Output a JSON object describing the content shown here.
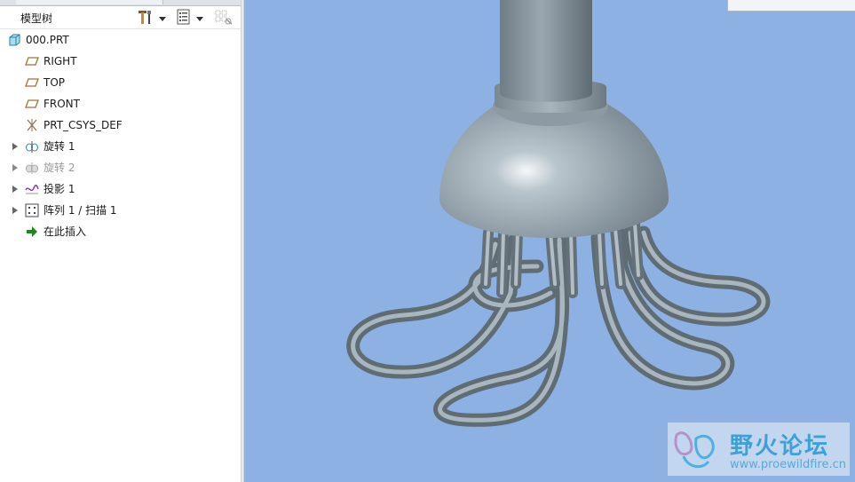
{
  "model_tree": {
    "title": "模型树",
    "nodes": [
      {
        "label": "000.PRT",
        "icon": "part-icon",
        "expander": false,
        "disabled": false
      },
      {
        "label": "RIGHT",
        "icon": "datum-plane-icon",
        "expander": false,
        "disabled": false
      },
      {
        "label": "TOP",
        "icon": "datum-plane-icon",
        "expander": false,
        "disabled": false
      },
      {
        "label": "FRONT",
        "icon": "datum-plane-icon",
        "expander": false,
        "disabled": false
      },
      {
        "label": "PRT_CSYS_DEF",
        "icon": "coordinate-system-icon",
        "expander": false,
        "disabled": false
      },
      {
        "label": "旋转 1",
        "icon": "revolve-icon",
        "expander": true,
        "disabled": false
      },
      {
        "label": "旋转 2",
        "icon": "revolve-icon",
        "expander": true,
        "disabled": true
      },
      {
        "label": "投影 1",
        "icon": "projection-curve-icon",
        "expander": true,
        "disabled": false
      },
      {
        "label": "阵列 1 / 扫描 1",
        "icon": "pattern-icon",
        "expander": true,
        "disabled": false
      },
      {
        "label": "在此插入",
        "icon": "insert-here-arrow-icon",
        "expander": false,
        "disabled": false
      }
    ]
  },
  "watermark": {
    "title": "野火论坛",
    "url": "www.proewildfire.cn"
  },
  "colors": {
    "viewport_bg": "#8db1e3",
    "model_body": "#8f9da6",
    "model_highlight": "#eef3f6",
    "datum_plane": "#a0703a",
    "insert_arrow": "#1b8a1b"
  }
}
